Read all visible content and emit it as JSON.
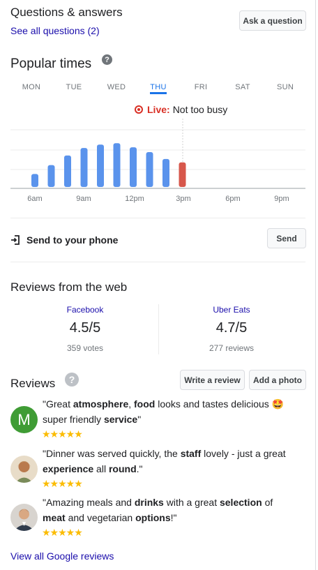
{
  "qa": {
    "title": "Questions & answers",
    "see_all": "See all questions (2)",
    "ask_button": "Ask a question"
  },
  "popular_times": {
    "title": "Popular times",
    "help_icon": "question-circle-icon",
    "days": [
      "MON",
      "TUE",
      "WED",
      "THU",
      "FRI",
      "SAT",
      "SUN"
    ],
    "active_day": "THU",
    "live_label": "Live:",
    "live_status": "Not too busy",
    "colors": {
      "bar": "#5a93ec",
      "live_bar": "#d7574b",
      "active": "#1a73e8",
      "live": "#d93025"
    }
  },
  "chart_data": {
    "type": "bar",
    "categories": [
      "6am",
      "7am",
      "8am",
      "9am",
      "10am",
      "11am",
      "12pm",
      "1pm",
      "2pm",
      "3pm"
    ],
    "values": [
      19,
      32,
      46,
      57,
      62,
      64,
      58,
      51,
      41,
      36
    ],
    "highlight_index": 9,
    "ylim": [
      0,
      100
    ],
    "x_tick_labels": [
      "6am",
      "9am",
      "12pm",
      "3pm",
      "6pm",
      "9pm"
    ],
    "grid": true
  },
  "send": {
    "label": "Send to your phone",
    "button": "Send"
  },
  "web_reviews": {
    "title": "Reviews from the web",
    "sources": [
      {
        "name": "Facebook",
        "score": "4.5/5",
        "count": "359 votes"
      },
      {
        "name": "Uber Eats",
        "score": "4.7/5",
        "count": "277 reviews"
      }
    ]
  },
  "reviews": {
    "title": "Reviews",
    "write_button": "Write a review",
    "photo_button": "Add a photo",
    "items": [
      {
        "avatar_letter": "M",
        "avatar_color": "#3f9c35",
        "stars": "★★★★★",
        "parts": [
          "\"Great ",
          "atmosphere",
          ", ",
          "food",
          " looks and tastes delicious ",
          "🤩",
          " super friendly ",
          "service",
          "\""
        ]
      },
      {
        "avatar_letter": "",
        "avatar_color": "#c49a6c",
        "stars": "★★★★★",
        "parts": [
          "\"Dinner was served quickly, the ",
          "staff",
          " lovely - just a great ",
          "experience",
          " all ",
          "round",
          ".\""
        ]
      },
      {
        "avatar_letter": "",
        "avatar_color": "#8a6e5a",
        "stars": "★★★★★",
        "parts": [
          "\"Amazing meals and ",
          "drinks",
          " with a great ",
          "selection",
          " of ",
          "meat",
          " and vegetarian ",
          "options",
          "!\""
        ]
      }
    ],
    "view_all": "View all Google reviews"
  }
}
